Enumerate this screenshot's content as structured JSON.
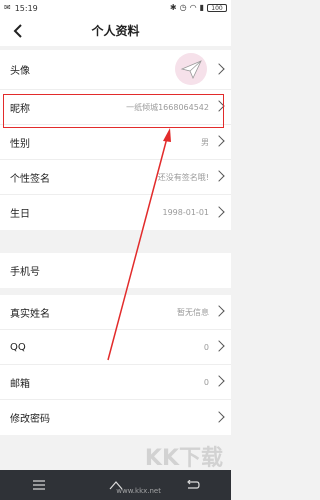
{
  "status_bar": {
    "time": "15:19",
    "battery": "100"
  },
  "header": {
    "title": "个人资料"
  },
  "profile_rows": [
    {
      "label": "头像"
    },
    {
      "label": "昵称",
      "value": "一纸倾城1668064542"
    },
    {
      "label": "性别",
      "value": "男"
    },
    {
      "label": "个性签名",
      "value": "还没有签名哦!"
    },
    {
      "label": "生日",
      "value": "1998-01-01"
    }
  ],
  "phone_row": {
    "label": "手机号"
  },
  "account_rows": [
    {
      "label": "真实姓名",
      "value": "暂无信息"
    },
    {
      "label": "QQ",
      "value": "0"
    },
    {
      "label": "邮箱",
      "value": "0"
    },
    {
      "label": "修改密码"
    }
  ],
  "watermark": {
    "text": "KK下载",
    "url": "www.kkx.net"
  },
  "colors": {
    "highlight": "#e22b2b",
    "nav_bar": "#2f3237",
    "background": "#f2f2f2"
  }
}
